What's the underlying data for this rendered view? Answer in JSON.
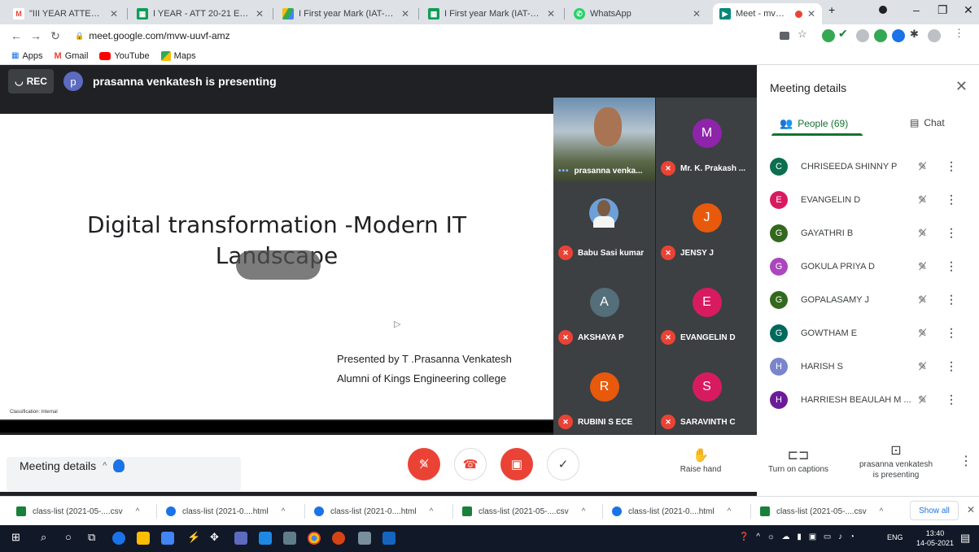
{
  "browser": {
    "tabs": [
      {
        "title": "\"III YEAR ATTENDANCE\" - g",
        "favicon": "gmail-icon",
        "color": "#ea4335"
      },
      {
        "title": "I YEAR - ATT 20-21 EVEN-W",
        "favicon": "sheets-icon",
        "color": "#0f9d58"
      },
      {
        "title": "I First year Mark (IAT-1).xlsx",
        "favicon": "drive-icon",
        "color": "#fbbc04"
      },
      {
        "title": "I First year Mark (IAT-1).xlsx",
        "favicon": "sheets-icon",
        "color": "#0f9d58"
      },
      {
        "title": "WhatsApp",
        "favicon": "whatsapp-icon",
        "color": "#25d366"
      },
      {
        "title": "Meet - mvw-uuvf-amz",
        "favicon": "meet-icon",
        "color": "#00897b"
      }
    ],
    "url": "meet.google.com/mvw-uuvf-amz",
    "bookmarks": [
      {
        "label": "Apps"
      },
      {
        "label": "Gmail"
      },
      {
        "label": "YouTube"
      },
      {
        "label": "Maps"
      }
    ]
  },
  "meet": {
    "rec_label": "REC",
    "presenter_initial": "p",
    "presenting_text": "prasanna venkatesh is presenting",
    "slide": {
      "title_line1": "Digital transformation -Modern IT",
      "title_line2": "Landscape",
      "credit_line1": "Presented by T .Prasanna Venkatesh",
      "credit_line2": "Alumni of Kings Engineering college",
      "classification": "Classification: Internal"
    },
    "tiles": [
      {
        "name": "prasanna venka...",
        "initial": "",
        "color": "",
        "kind": "video"
      },
      {
        "name": "Mr. K. Prakash ...",
        "initial": "M",
        "color": "#8e24aa",
        "kind": "avatar"
      },
      {
        "name": "Babu Sasi kumar",
        "initial": "",
        "color": "",
        "kind": "photo"
      },
      {
        "name": "JENSY J",
        "initial": "J",
        "color": "#e8590c",
        "kind": "avatar"
      },
      {
        "name": "AKSHAYA P",
        "initial": "A",
        "color": "#546e7a",
        "kind": "avatar"
      },
      {
        "name": "EVANGELIN D",
        "initial": "E",
        "color": "#d81b60",
        "kind": "avatar"
      },
      {
        "name": "RUBINI S ECE",
        "initial": "R",
        "color": "#e8590c",
        "kind": "avatar"
      },
      {
        "name": "SARAVINTH C",
        "initial": "S",
        "color": "#d81b60",
        "kind": "avatar"
      }
    ],
    "panel": {
      "title": "Meeting details",
      "people_tab": "People (69)",
      "chat_tab": "Chat",
      "people": [
        {
          "name": "CHRISEEDA SHINNY P",
          "initial": "C",
          "color": "#0b6e4f"
        },
        {
          "name": "EVANGELIN D",
          "initial": "E",
          "color": "#d81b60"
        },
        {
          "name": "GAYATHRI B",
          "initial": "G",
          "color": "#33691e"
        },
        {
          "name": "GOKULA PRIYA D",
          "initial": "G",
          "color": "#ab47bc"
        },
        {
          "name": "GOPALASAMY J",
          "initial": "G",
          "color": "#33691e"
        },
        {
          "name": "GOWTHAM E",
          "initial": "G",
          "color": "#00695c"
        },
        {
          "name": "HARISH S",
          "initial": "H",
          "color": "#7986cb"
        },
        {
          "name": "HARRIESH BEAULAH M ...",
          "initial": "H",
          "color": "#6a1b9a"
        }
      ]
    },
    "controls": {
      "meeting_details": "Meeting details",
      "raise_hand": "Raise hand",
      "captions": "Turn on captions",
      "presenting_line1": "prasanna venkatesh",
      "presenting_line2": "is presenting"
    }
  },
  "downloads": {
    "items": [
      {
        "name": "class-list (2021-05-....csv",
        "type": "csv"
      },
      {
        "name": "class-list (2021-0....html",
        "type": "html"
      },
      {
        "name": "class-list (2021-0....html",
        "type": "html"
      },
      {
        "name": "class-list (2021-05-....csv",
        "type": "csv"
      },
      {
        "name": "class-list (2021-0....html",
        "type": "html"
      },
      {
        "name": "class-list (2021-05-....csv",
        "type": "csv"
      }
    ],
    "show_all": "Show all"
  },
  "taskbar": {
    "lang": "ENG",
    "time": "13:40",
    "date": "14-05-2021"
  }
}
